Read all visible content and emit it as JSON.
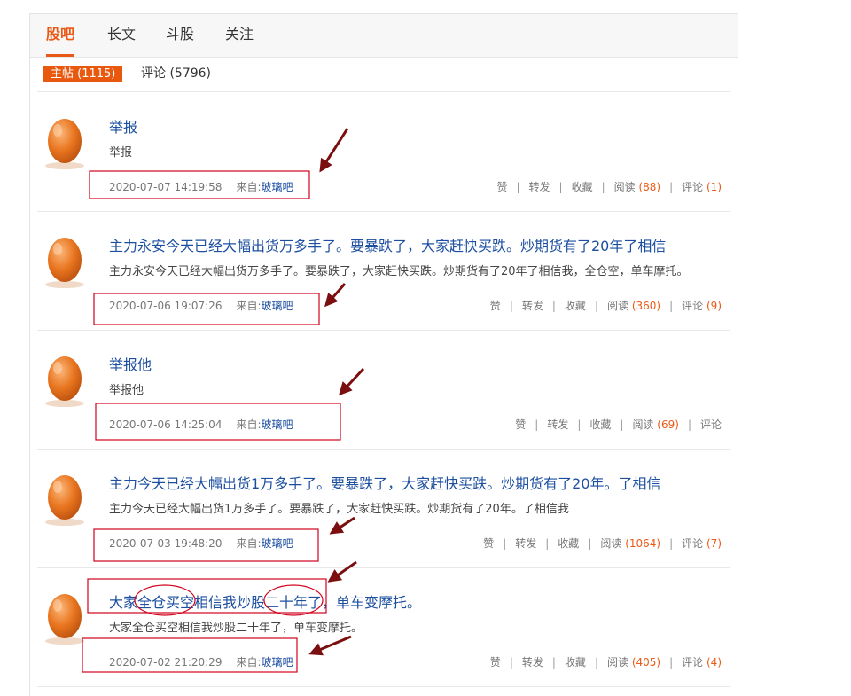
{
  "tabs": [
    {
      "label": "股吧",
      "active": true
    },
    {
      "label": "长文",
      "active": false
    },
    {
      "label": "斗股",
      "active": false
    },
    {
      "label": "关注",
      "active": false
    }
  ],
  "subtabs": {
    "posts": "主帖 (1115)",
    "comments": "评论 (5796)"
  },
  "labels": {
    "from": "来自:",
    "like": "赞",
    "share": "转发",
    "favorite": "收藏",
    "read": "阅读",
    "comment": "评论",
    "sep": "|"
  },
  "posts": [
    {
      "title": "举报",
      "summary": "举报",
      "time": "2020-07-07 14:19:58",
      "source": "玻璃吧",
      "reads": "(88)",
      "comments": "(1)"
    },
    {
      "title": "主力永安今天已经大幅出货万多手了。要暴跌了，大家赶快买跌。炒期货有了20年了相信",
      "summary": "主力永安今天已经大幅出货万多手了。要暴跌了，大家赶快买跌。炒期货有了20年了相信我，全仓空，单车摩托。",
      "time": "2020-07-06 19:07:26",
      "source": "玻璃吧",
      "reads": "(360)",
      "comments": "(9)"
    },
    {
      "title": "举报他",
      "summary": "举报他",
      "time": "2020-07-06 14:25:04",
      "source": "玻璃吧",
      "reads": "(69)",
      "comments": ""
    },
    {
      "title": "主力今天已经大幅出货1万多手了。要暴跌了，大家赶快买跌。炒期货有了20年。了相信",
      "summary": "主力今天已经大幅出货1万多手了。要暴跌了，大家赶快买跌。炒期货有了20年。了相信我",
      "time": "2020-07-03 19:48:20",
      "source": "玻璃吧",
      "reads": "(1064)",
      "comments": "(7)"
    },
    {
      "title": "大家全仓买空相信我炒股二十年了，单车变摩托。",
      "summary": "大家全仓买空相信我炒股二十年了，单车变摩托。",
      "time": "2020-07-02 21:20:29",
      "source": "玻璃吧",
      "reads": "(405)",
      "comments": "(4)"
    }
  ],
  "colors": {
    "accent": "#e8590f",
    "link": "#1d4fa0",
    "annotation": "#d0021b",
    "arrow": "#7b0f0f"
  }
}
